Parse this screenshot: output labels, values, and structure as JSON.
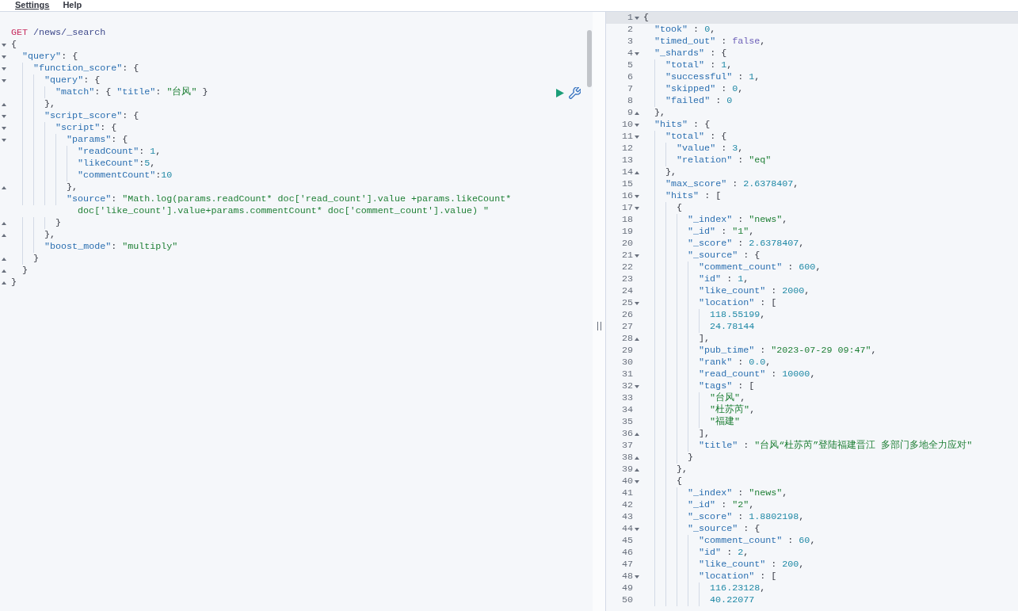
{
  "menu": [
    {
      "label": "Settings",
      "selected": true
    },
    {
      "label": "Help",
      "selected": false
    }
  ],
  "request": {
    "method": "GET",
    "path": "/news/_search",
    "body": [
      {
        "text": "{",
        "kind": "open"
      },
      {
        "text": "  \"query\": {",
        "kind": "open"
      },
      {
        "text": "    \"function_score\": {",
        "kind": "open"
      },
      {
        "text": "      \"query\": {",
        "kind": "open"
      },
      {
        "text": "        \"match\": { \"title\": \"台风\" }",
        "kind": "plain"
      },
      {
        "text": "      },",
        "kind": "close"
      },
      {
        "text": "      \"script_score\": {",
        "kind": "open"
      },
      {
        "text": "        \"script\": {",
        "kind": "open"
      },
      {
        "text": "          \"params\": {",
        "kind": "open"
      },
      {
        "text": "            \"readCount\": 1,",
        "kind": "plain"
      },
      {
        "text": "            \"likeCount\":5,",
        "kind": "plain"
      },
      {
        "text": "            \"commentCount\":10",
        "kind": "plain"
      },
      {
        "text": "          },",
        "kind": "close"
      },
      {
        "text": "          \"source\": \"Math.log(params.readCount* doc['read_count'].value +params.likeCount* doc['like_count'].value+params.commentCount* doc['comment_count'].value) \"",
        "kind": "plain"
      },
      {
        "text": "        }",
        "kind": "close"
      },
      {
        "text": "      },",
        "kind": "close"
      },
      {
        "text": "      \"boost_mode\": \"multiply\"",
        "kind": "plain"
      },
      {
        "text": "    }",
        "kind": "close"
      },
      {
        "text": "  }",
        "kind": "close"
      },
      {
        "text": "}",
        "kind": "close"
      }
    ]
  },
  "response": {
    "lines": [
      {
        "number": "1",
        "text": "{",
        "kind": "open",
        "active": true
      },
      {
        "number": "2",
        "text": "  \"took\" : 0,",
        "kind": "plain",
        "active": false
      },
      {
        "number": "3",
        "text": "  \"timed_out\" : false,",
        "kind": "plain",
        "active": false
      },
      {
        "number": "4",
        "text": "  \"_shards\" : {",
        "kind": "open",
        "active": false
      },
      {
        "number": "5",
        "text": "    \"total\" : 1,",
        "kind": "plain",
        "active": false
      },
      {
        "number": "6",
        "text": "    \"successful\" : 1,",
        "kind": "plain",
        "active": false
      },
      {
        "number": "7",
        "text": "    \"skipped\" : 0,",
        "kind": "plain",
        "active": false
      },
      {
        "number": "8",
        "text": "    \"failed\" : 0",
        "kind": "plain",
        "active": false
      },
      {
        "number": "9",
        "text": "  },",
        "kind": "close",
        "active": false
      },
      {
        "number": "10",
        "text": "  \"hits\" : {",
        "kind": "open",
        "active": false
      },
      {
        "number": "11",
        "text": "    \"total\" : {",
        "kind": "open",
        "active": false
      },
      {
        "number": "12",
        "text": "      \"value\" : 3,",
        "kind": "plain",
        "active": false
      },
      {
        "number": "13",
        "text": "      \"relation\" : \"eq\"",
        "kind": "plain",
        "active": false
      },
      {
        "number": "14",
        "text": "    },",
        "kind": "close",
        "active": false
      },
      {
        "number": "15",
        "text": "    \"max_score\" : 2.6378407,",
        "kind": "plain",
        "active": false
      },
      {
        "number": "16",
        "text": "    \"hits\" : [",
        "kind": "open",
        "active": false
      },
      {
        "number": "17",
        "text": "      {",
        "kind": "open",
        "active": false
      },
      {
        "number": "18",
        "text": "        \"_index\" : \"news\",",
        "kind": "plain",
        "active": false
      },
      {
        "number": "19",
        "text": "        \"_id\" : \"1\",",
        "kind": "plain",
        "active": false
      },
      {
        "number": "20",
        "text": "        \"_score\" : 2.6378407,",
        "kind": "plain",
        "active": false
      },
      {
        "number": "21",
        "text": "        \"_source\" : {",
        "kind": "open",
        "active": false
      },
      {
        "number": "22",
        "text": "          \"comment_count\" : 600,",
        "kind": "plain",
        "active": false
      },
      {
        "number": "23",
        "text": "          \"id\" : 1,",
        "kind": "plain",
        "active": false
      },
      {
        "number": "24",
        "text": "          \"like_count\" : 2000,",
        "kind": "plain",
        "active": false
      },
      {
        "number": "25",
        "text": "          \"location\" : [",
        "kind": "open",
        "active": false
      },
      {
        "number": "26",
        "text": "            118.55199,",
        "kind": "plain",
        "active": false
      },
      {
        "number": "27",
        "text": "            24.78144",
        "kind": "plain",
        "active": false
      },
      {
        "number": "28",
        "text": "          ],",
        "kind": "close",
        "active": false
      },
      {
        "number": "29",
        "text": "          \"pub_time\" : \"2023-07-29 09:47\",",
        "kind": "plain",
        "active": false
      },
      {
        "number": "30",
        "text": "          \"rank\" : 0.0,",
        "kind": "plain",
        "active": false
      },
      {
        "number": "31",
        "text": "          \"read_count\" : 10000,",
        "kind": "plain",
        "active": false
      },
      {
        "number": "32",
        "text": "          \"tags\" : [",
        "kind": "open",
        "active": false
      },
      {
        "number": "33",
        "text": "            \"台风\",",
        "kind": "plain",
        "active": false
      },
      {
        "number": "34",
        "text": "            \"杜苏芮\",",
        "kind": "plain",
        "active": false
      },
      {
        "number": "35",
        "text": "            \"福建\"",
        "kind": "plain",
        "active": false
      },
      {
        "number": "36",
        "text": "          ],",
        "kind": "close",
        "active": false
      },
      {
        "number": "37",
        "text": "          \"title\" : \"台风“杜苏芮”登陆福建晋江 多部门多地全力应对\"",
        "kind": "plain",
        "active": false
      },
      {
        "number": "38",
        "text": "        }",
        "kind": "close",
        "active": false
      },
      {
        "number": "39",
        "text": "      },",
        "kind": "close",
        "active": false
      },
      {
        "number": "40",
        "text": "      {",
        "kind": "open",
        "active": false
      },
      {
        "number": "41",
        "text": "        \"_index\" : \"news\",",
        "kind": "plain",
        "active": false
      },
      {
        "number": "42",
        "text": "        \"_id\" : \"2\",",
        "kind": "plain",
        "active": false
      },
      {
        "number": "43",
        "text": "        \"_score\" : 1.8802198,",
        "kind": "plain",
        "active": false
      },
      {
        "number": "44",
        "text": "        \"_source\" : {",
        "kind": "open",
        "active": false
      },
      {
        "number": "45",
        "text": "          \"comment_count\" : 60,",
        "kind": "plain",
        "active": false
      },
      {
        "number": "46",
        "text": "          \"id\" : 2,",
        "kind": "plain",
        "active": false
      },
      {
        "number": "47",
        "text": "          \"like_count\" : 200,",
        "kind": "plain",
        "active": false
      },
      {
        "number": "48",
        "text": "          \"location\" : [",
        "kind": "open",
        "active": false
      },
      {
        "number": "49",
        "text": "            116.23128,",
        "kind": "plain",
        "active": false
      },
      {
        "number": "50",
        "text": "            40.22077",
        "kind": "plain",
        "active": false
      }
    ]
  }
}
